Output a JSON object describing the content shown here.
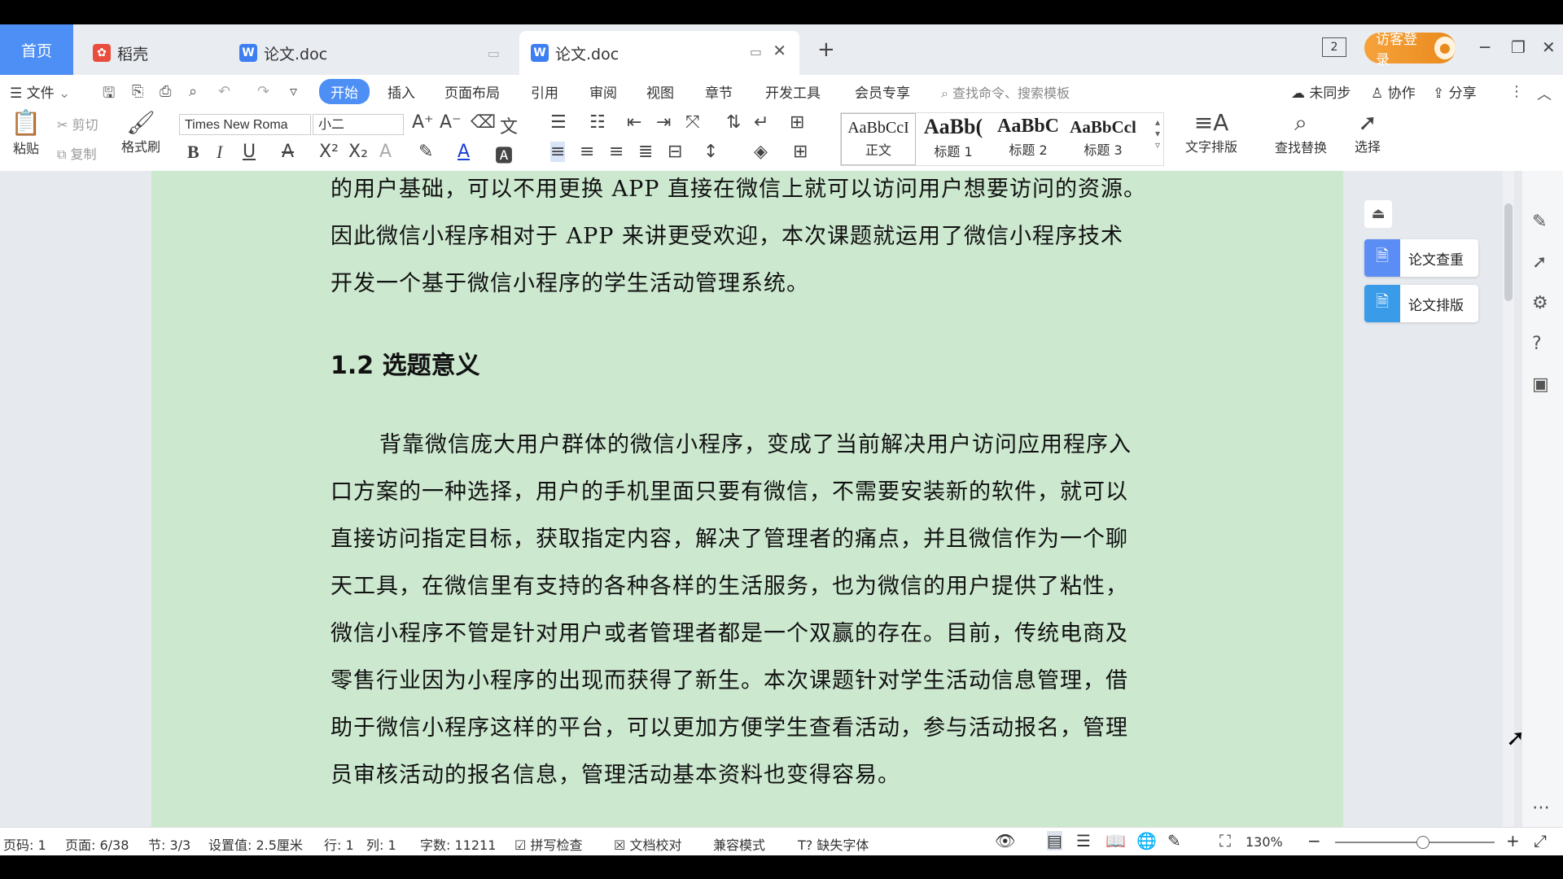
{
  "tabs": {
    "home": "首页",
    "daoke": "稻壳",
    "doc1": "论文.doc",
    "doc2": "论文.doc"
  },
  "window": {
    "login": "访客登录",
    "tab_count": "2"
  },
  "menu": {
    "file": "文件",
    "start": "开始",
    "insert": "插入",
    "layout": "页面布局",
    "reference": "引用",
    "review": "审阅",
    "view": "视图",
    "chapter": "章节",
    "dev": "开发工具",
    "member": "会员专享",
    "search_placeholder": "查找命令、搜索模板",
    "unsync": "未同步",
    "collab": "协作",
    "share": "分享"
  },
  "ribbon": {
    "paste": "粘贴",
    "cut": "剪切",
    "copy": "复制",
    "format_painter": "格式刷",
    "font_name": "Times New Roma",
    "font_size": "小二",
    "styles": [
      {
        "sample": "AaBbCcI",
        "name": "正文"
      },
      {
        "sample": "AaBb(",
        "name": "标题 1"
      },
      {
        "sample": "AaBbC",
        "name": "标题 2"
      },
      {
        "sample": "AaBbCcl",
        "name": "标题 3"
      }
    ],
    "text_layout": "文字排版",
    "find_replace": "查找替换",
    "select": "选择"
  },
  "document": {
    "lines_top": [
      "的用户基础，可以不用更换 APP 直接在微信上就可以访问用户想要访问的资源。",
      "因此微信小程序相对于 APP 来讲更受欢迎，本次课题就运用了微信小程序技术",
      "开发一个基于微信小程序的学生活动管理系统。"
    ],
    "heading": "1.2  选题意义",
    "lines_body": [
      "背靠微信庞大用户群体的微信小程序，变成了当前解决用户访问应用程序入",
      "口方案的一种选择，用户的手机里面只要有微信，不需要安装新的软件，就可以",
      "直接访问指定目标，获取指定内容，解决了管理者的痛点，并且微信作为一个聊",
      "天工具，在微信里有支持的各种各样的生活服务，也为微信的用户提供了粘性，",
      "微信小程序不管是针对用户或者管理者都是一个双赢的存在。目前，传统电商及",
      "零售行业因为小程序的出现而获得了新生。本次课题针对学生活动信息管理，借",
      "助于微信小程序这样的平台，可以更加方便学生查看活动，参与活动报名，管理",
      "员审核活动的报名信息，管理活动基本资料也变得容易。"
    ]
  },
  "side_panel": {
    "check": "论文查重",
    "format": "论文排版"
  },
  "status": {
    "page_code": "页码: 1",
    "page": "页面: 6/38",
    "section": "节: 3/3",
    "setting": "设置值: 2.5厘米",
    "row": "行: 1",
    "col": "列: 1",
    "words": "字数: 11211",
    "spell": "拼写检查",
    "proof": "文档校对",
    "compat": "兼容模式",
    "missing_font": "缺失字体",
    "zoom": "130%"
  }
}
